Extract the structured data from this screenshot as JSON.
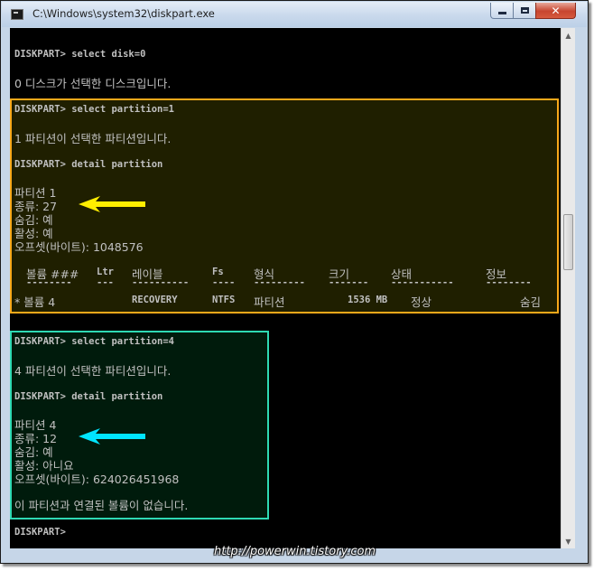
{
  "window": {
    "title": "C:\\Windows\\system32\\diskpart.exe",
    "minimize_label": "—",
    "close_label": "✕"
  },
  "colors": {
    "highlight_box_1": "#f7a81a",
    "highlight_box_2": "#2ed9b3",
    "arrow_1": "#ffee00",
    "arrow_2": "#00e5ff",
    "console_background": "#000000",
    "console_text": "#c0c0c0"
  },
  "console": {
    "cmd_select_disk": "DISKPART> select disk=0",
    "msg_disk_selected": "0 디스크가 선택한 디스크입니다.",
    "cmd_select_partition_1": "DISKPART> select partition=1",
    "msg_partition_1_selected": "1 파티션이 선택한 파티션입니다.",
    "cmd_detail_partition_1": "DISKPART> detail partition",
    "p1_partition": "파티션 1",
    "p1_type": "종류: 27",
    "p1_hidden": "숨김: 예",
    "p1_active": "활성: 예",
    "p1_offset": "오프셋(바이트): 1048576",
    "vol_header": {
      "volume": "볼륨 ###",
      "ltr": "Ltr",
      "label": "레이블",
      "fs": "Fs",
      "type": "형식",
      "size": "크기",
      "status": "상태",
      "info": "정보"
    },
    "vol_separator": {
      "volume": "--------",
      "ltr": "---",
      "label": "----------",
      "fs": "----",
      "type": "---------",
      "size": "-------",
      "status": "-----------",
      "info": "--------"
    },
    "vol_row": {
      "volume": "* 볼륨 4",
      "label": "RECOVERY",
      "fs": "NTFS",
      "type": "파티션",
      "size": "1536 MB",
      "status": "정상",
      "info": "숨김"
    },
    "cmd_select_partition_4": "DISKPART> select partition=4",
    "msg_partition_4_selected": "4 파티션이 선택한 파티션입니다.",
    "cmd_detail_partition_4": "DISKPART> detail partition",
    "p4_partition": "파티션 4",
    "p4_type": "종류: 12",
    "p4_hidden": "숨김: 예",
    "p4_active": "활성: 아니요",
    "p4_offset": "오프셋(바이트): 624026451968",
    "msg_no_volume": "이 파티션과 연결된 볼륨이 없습니다.",
    "prompt": "DISKPART>"
  },
  "watermark": "http://powerwin.tistory.com"
}
